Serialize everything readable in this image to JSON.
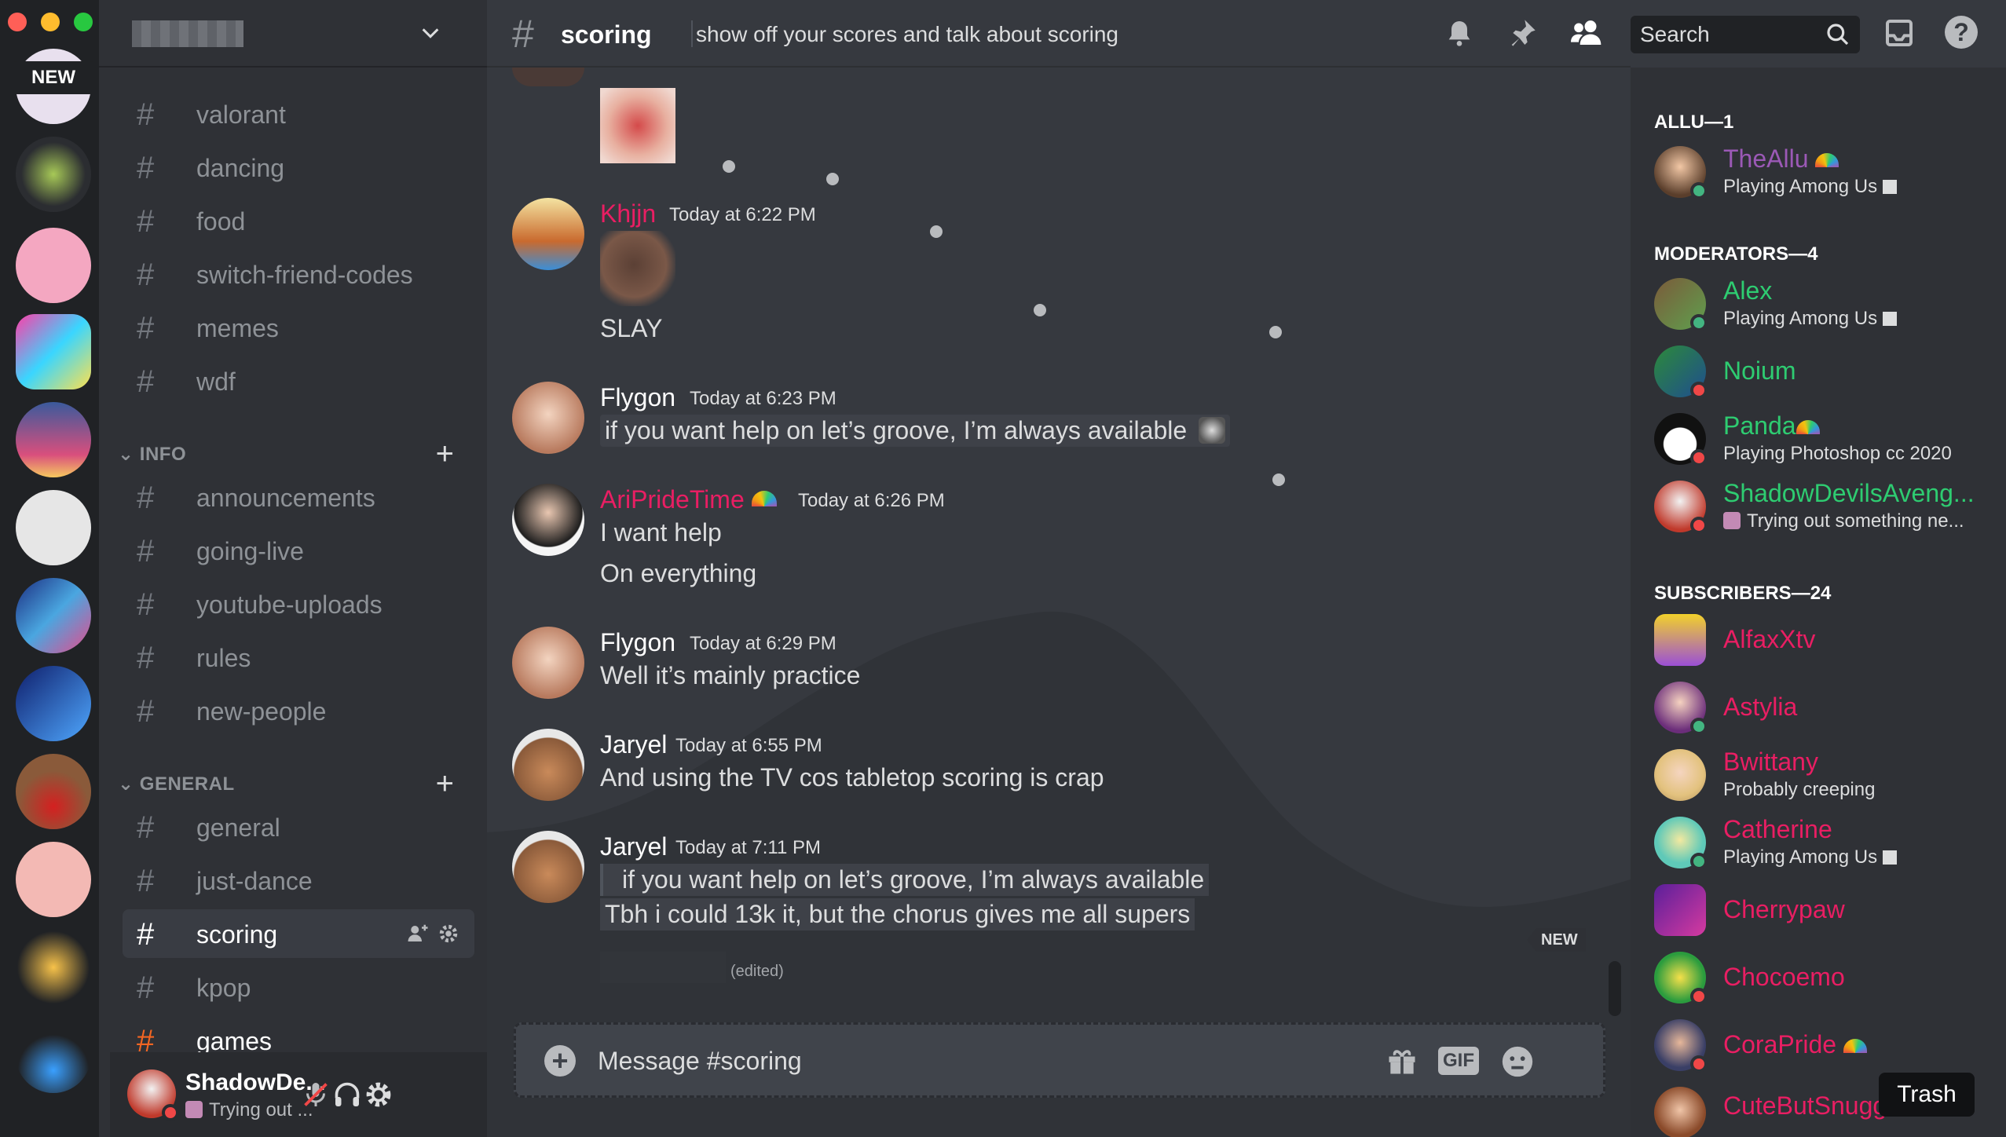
{
  "rail": {
    "new_badge": "NEW",
    "servers": [
      "server-1",
      "server-2",
      "server-3",
      "server-4",
      "server-5",
      "server-6",
      "server-7",
      "server-8",
      "server-9",
      "server-10",
      "server-11",
      "server-12"
    ]
  },
  "sidebar": {
    "channels_top": [
      {
        "label": "valorant"
      },
      {
        "label": "dancing"
      },
      {
        "label": "food"
      },
      {
        "label": "switch-friend-codes"
      },
      {
        "label": "memes"
      },
      {
        "label": "wdf"
      }
    ],
    "info_category": "INFO",
    "info_channels": [
      {
        "label": "announcements"
      },
      {
        "label": "going-live"
      },
      {
        "label": "youtube-uploads"
      },
      {
        "label": "rules"
      },
      {
        "label": "new-people"
      }
    ],
    "general_category": "GENERAL",
    "general_channels": [
      {
        "label": "general"
      },
      {
        "label": "just-dance"
      },
      {
        "label": "scoring"
      },
      {
        "label": "kpop"
      },
      {
        "label": "games"
      }
    ],
    "user": {
      "name": "ShadowDe...",
      "status": "Trying out ..."
    }
  },
  "chat": {
    "channel": "scoring",
    "topic": "show off your scores and talk about scoring",
    "search_placeholder": "Search",
    "messages": [
      {
        "author": "Khjjn",
        "time": "Today at 6:22 PM",
        "lines": [
          "SLAY"
        ]
      },
      {
        "author": "Flygon",
        "time": "Today at 6:23 PM",
        "lines": [
          "if you want help on let’s groove, I’m always available"
        ]
      },
      {
        "author": "AriPrideTime",
        "time": "Today at 6:26 PM",
        "lines": [
          "I want help",
          "On everything"
        ]
      },
      {
        "author": "Flygon",
        "time": "Today at 6:29 PM",
        "lines": [
          "Well it’s mainly practice"
        ]
      },
      {
        "author": "Jaryel",
        "time": "Today at 6:55 PM",
        "lines": [
          "And using the TV cos tabletop scoring is crap"
        ]
      },
      {
        "author": "Jaryel",
        "time": "Today at 7:11 PM",
        "quote": "if you want help on let’s groove, I’m always available",
        "lines": [
          "Tbh i could 13k it, but the chorus gives me all supers"
        ]
      }
    ],
    "edited_label": "(edited)",
    "new_label": "NEW",
    "composer_placeholder": "Message #scoring",
    "gif_label": "GIF"
  },
  "members": {
    "groups": [
      {
        "title": "ALLU—1"
      },
      {
        "title": "MODERATORS—4"
      },
      {
        "title": "SUBSCRIBERS—24"
      }
    ],
    "list": [
      {
        "name": "TheAllu",
        "status": "Playing Among Us",
        "color": "#9b59b6"
      },
      {
        "name": "Alex",
        "status": "Playing Among Us",
        "color": "#2ecc71"
      },
      {
        "name": "Noium",
        "status": "",
        "color": "#2ecc71"
      },
      {
        "name": "Panda",
        "status": "Playing Photoshop cc 2020",
        "color": "#2ecc71"
      },
      {
        "name": "ShadowDevilsAveng...",
        "status": "Trying out something ne...",
        "color": "#2ecc71"
      },
      {
        "name": "AlfaxXtv",
        "status": "",
        "color": "#e91e63"
      },
      {
        "name": "Astylia",
        "status": "",
        "color": "#e91e63"
      },
      {
        "name": "Bwittany",
        "status": "Probably creeping",
        "color": "#e91e63"
      },
      {
        "name": "Catherine",
        "status": "Playing Among Us",
        "color": "#e91e63"
      },
      {
        "name": "Cherrypaw",
        "status": "",
        "color": "#e91e63"
      },
      {
        "name": "Chocoemo",
        "status": "",
        "color": "#e91e63"
      },
      {
        "name": "CoraPride",
        "status": "",
        "color": "#e91e63"
      },
      {
        "name": "CuteButSnugg...",
        "status": "",
        "color": "#e91e63"
      }
    ]
  },
  "tooltip": "Trash",
  "colors": {
    "accent": "#7289da",
    "mod": "#2ecc71",
    "sub": "#e91e63",
    "allu": "#9b59b6",
    "unread": "#f26522"
  }
}
